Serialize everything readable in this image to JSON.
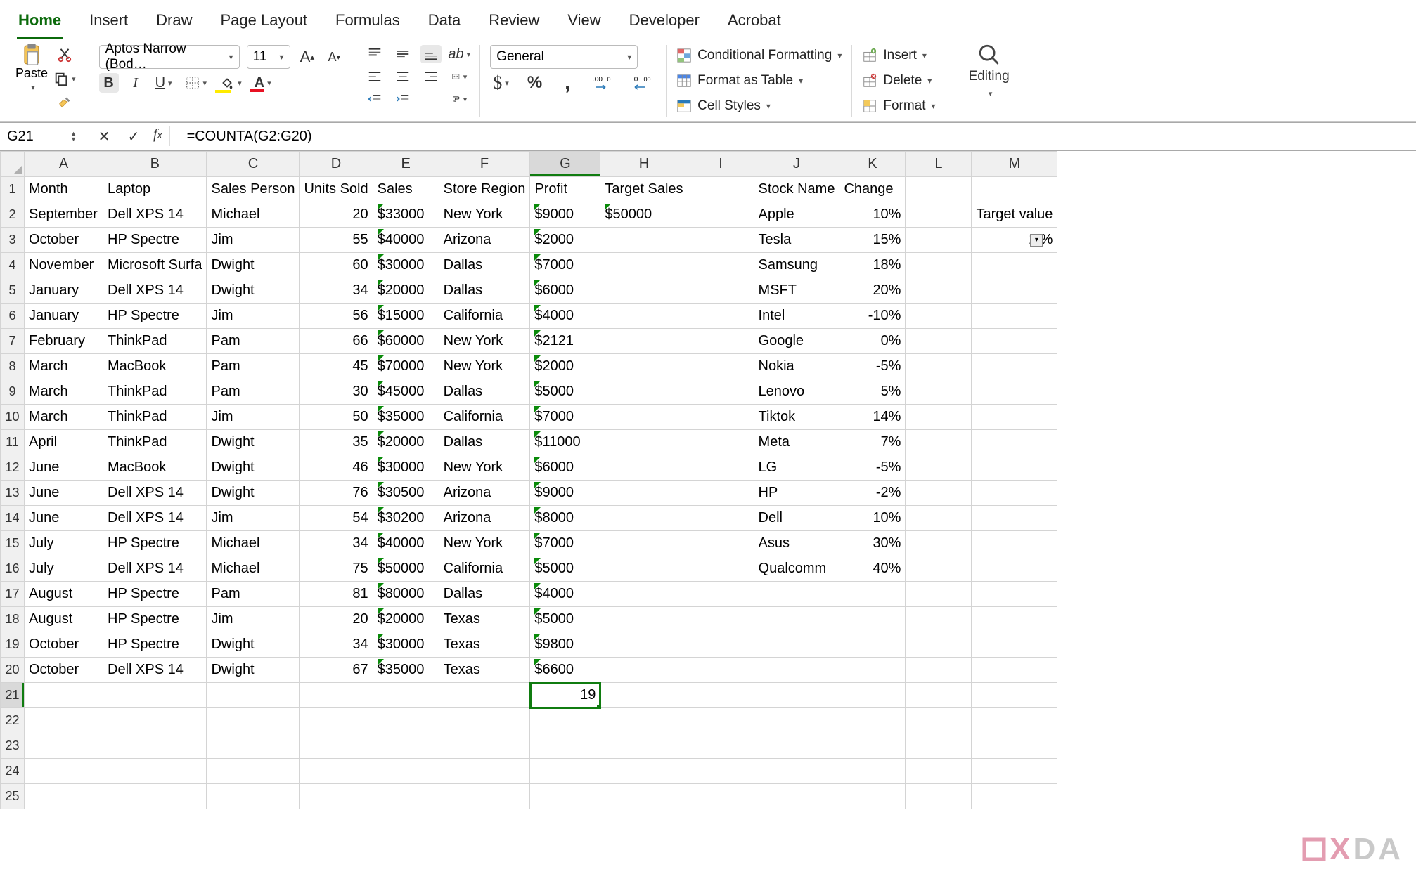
{
  "tabs": [
    "Home",
    "Insert",
    "Draw",
    "Page Layout",
    "Formulas",
    "Data",
    "Review",
    "View",
    "Developer",
    "Acrobat"
  ],
  "active_tab": "Home",
  "clipboard": {
    "paste_label": "Paste"
  },
  "font": {
    "name": "Aptos Narrow (Bod…",
    "size": "11",
    "bold": "B",
    "italic": "I",
    "underline": "U"
  },
  "alignment": {},
  "number": {
    "format": "General"
  },
  "styles": {
    "cond": "Conditional Formatting",
    "table": "Format as Table",
    "cell": "Cell Styles"
  },
  "cells": {
    "insert": "Insert",
    "delete": "Delete",
    "format": "Format"
  },
  "editing": {
    "label": "Editing"
  },
  "namebox": "G21",
  "formula": "=COUNTA(G2:G20)",
  "columns": [
    "A",
    "B",
    "C",
    "D",
    "E",
    "F",
    "G",
    "H",
    "I",
    "J",
    "K",
    "L",
    "M"
  ],
  "active_col": "G",
  "active_row": 21,
  "headers": {
    "A": "Month",
    "B": "Laptop",
    "C": "Sales Person",
    "D": "Units Sold",
    "E": "Sales",
    "F": "Store Region",
    "G": "Profit",
    "H": "Target Sales",
    "J": "Stock Name",
    "K": "Change"
  },
  "m2_label": "Target value",
  "m3_value": "1    %",
  "g21_value": "19",
  "rows": [
    {
      "n": 2,
      "A": "September",
      "B": "Dell XPS 14",
      "C": "Michael",
      "D": 20,
      "E": "$33000",
      "F": "New York",
      "G": "$9000",
      "H": "$50000",
      "J": "Apple",
      "K": "10%"
    },
    {
      "n": 3,
      "A": "October",
      "B": "HP Spectre",
      "C": "Jim",
      "D": 55,
      "E": "$40000",
      "F": "Arizona",
      "G": "$2000",
      "J": "Tesla",
      "K": "15%",
      "Kblue": true
    },
    {
      "n": 4,
      "A": "November",
      "B": "Microsoft Surfa",
      "C": "Dwight",
      "D": 60,
      "E": "$30000",
      "F": "Dallas",
      "G": "$7000",
      "J": "Samsung",
      "K": "18%",
      "Kblue": true
    },
    {
      "n": 5,
      "A": "January",
      "B": "Dell XPS 14",
      "C": "Dwight",
      "D": 34,
      "E": "$20000",
      "F": "Dallas",
      "G": "$6000",
      "J": "MSFT",
      "K": "20%",
      "Kblue": true
    },
    {
      "n": 6,
      "A": "January",
      "B": "HP Spectre",
      "C": "Jim",
      "D": 56,
      "E": "$15000",
      "F": "California",
      "G": "$4000",
      "J": "Intel",
      "K": "-10%"
    },
    {
      "n": 7,
      "A": "February",
      "B": "ThinkPad",
      "C": "Pam",
      "D": 66,
      "E": "$60000",
      "Ered": true,
      "F": "New York",
      "G": "$2121",
      "J": "Google",
      "K": "0%"
    },
    {
      "n": 8,
      "A": "March",
      "B": "MacBook",
      "C": "Pam",
      "D": 45,
      "E": "$70000",
      "Ered": true,
      "F": "New York",
      "G": "$2000",
      "J": "Nokia",
      "K": "-5%"
    },
    {
      "n": 9,
      "A": "March",
      "B": "ThinkPad",
      "C": "Pam",
      "D": 30,
      "E": "$45000",
      "F": "Dallas",
      "G": "$5000",
      "J": "Lenovo",
      "K": "5%"
    },
    {
      "n": 10,
      "A": "March",
      "B": "ThinkPad",
      "C": "Jim",
      "D": 50,
      "E": "$35000",
      "F": "California",
      "G": "$7000",
      "J": "Tiktok",
      "K": "14%",
      "Kblue": true
    },
    {
      "n": 11,
      "A": "April",
      "B": "ThinkPad",
      "C": "Dwight",
      "D": 35,
      "E": "$20000",
      "F": "Dallas",
      "G": "$11000",
      "J": "Meta",
      "K": "7%"
    },
    {
      "n": 12,
      "A": "June",
      "B": "MacBook",
      "C": "Dwight",
      "D": 46,
      "E": "$30000",
      "F": "New York",
      "G": "$6000",
      "J": "LG",
      "K": "-5%"
    },
    {
      "n": 13,
      "A": "June",
      "B": "Dell XPS 14",
      "C": "Dwight",
      "D": 76,
      "E": "$30500",
      "F": "Arizona",
      "G": "$9000",
      "J": "HP",
      "K": "-2%"
    },
    {
      "n": 14,
      "A": "June",
      "B": "Dell XPS 14",
      "C": "Jim",
      "D": 54,
      "E": "$30200",
      "F": "Arizona",
      "G": "$8000",
      "J": "Dell",
      "K": "10%"
    },
    {
      "n": 15,
      "A": "July",
      "B": "HP Spectre",
      "C": "Michael",
      "D": 34,
      "E": "$40000",
      "F": "New York",
      "G": "$7000",
      "J": "Asus",
      "K": "30%",
      "Kblue": true
    },
    {
      "n": 16,
      "A": "July",
      "B": "Dell XPS 14",
      "C": "Michael",
      "D": 75,
      "E": "$50000",
      "F": "California",
      "G": "$5000",
      "J": "Qualcomm",
      "K": "40%",
      "Kblue": true
    },
    {
      "n": 17,
      "A": "August",
      "B": "HP Spectre",
      "C": "Pam",
      "D": 81,
      "E": "$80000",
      "Ered": true,
      "F": "Dallas",
      "G": "$4000"
    },
    {
      "n": 18,
      "A": "August",
      "B": "HP Spectre",
      "C": "Jim",
      "D": 20,
      "E": "$20000",
      "F": "Texas",
      "G": "$5000"
    },
    {
      "n": 19,
      "A": "October",
      "B": "HP Spectre",
      "C": "Dwight",
      "D": 34,
      "E": "$30000",
      "F": "Texas",
      "G": "$9800"
    },
    {
      "n": 20,
      "A": "October",
      "B": "Dell XPS 14",
      "C": "Dwight",
      "D": 67,
      "E": "$35000",
      "F": "Texas",
      "G": "$6600"
    }
  ],
  "blank_rows": [
    22,
    23,
    24,
    25
  ],
  "watermark": "XDA"
}
